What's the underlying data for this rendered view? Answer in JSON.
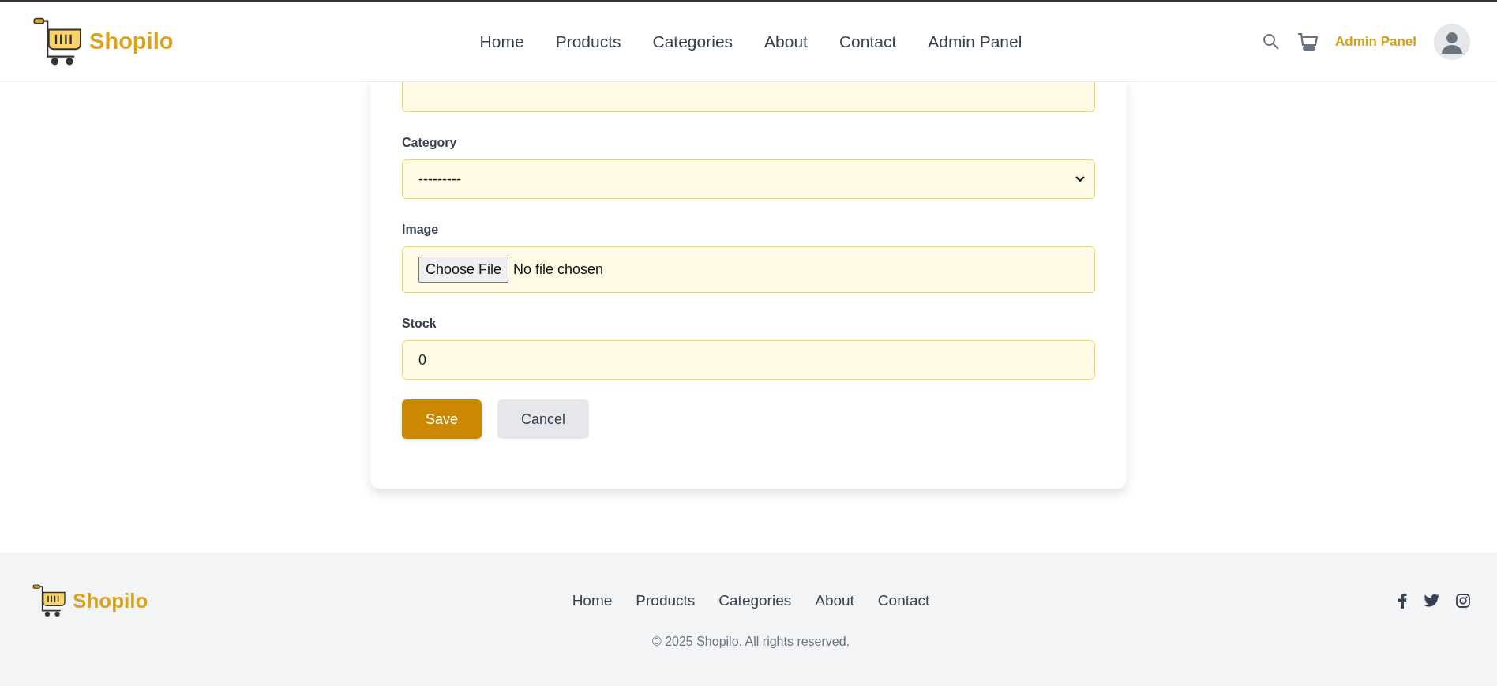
{
  "header": {
    "logo_text": "Shopilo",
    "nav": [
      {
        "label": "Home"
      },
      {
        "label": "Products"
      },
      {
        "label": "Categories"
      },
      {
        "label": "About"
      },
      {
        "label": "Contact"
      },
      {
        "label": "Admin Panel"
      }
    ],
    "admin_link": "Admin Panel"
  },
  "form": {
    "fields": [
      {
        "kind": "select",
        "label": "Category",
        "value": "---------"
      },
      {
        "kind": "file",
        "label": "Image",
        "button": "Choose File",
        "status": "No file chosen"
      },
      {
        "kind": "number",
        "label": "Stock",
        "value": "0"
      }
    ],
    "buttons": [
      {
        "label": "Save",
        "kind": "primary"
      },
      {
        "label": "Cancel",
        "kind": "secondary"
      }
    ]
  },
  "footer": {
    "logo_text": "Shopilo",
    "links": [
      {
        "label": "Home"
      },
      {
        "label": "Products"
      },
      {
        "label": "Categories"
      },
      {
        "label": "About"
      },
      {
        "label": "Contact"
      }
    ],
    "copyright": "© 2025 Shopilo. All rights reserved."
  }
}
